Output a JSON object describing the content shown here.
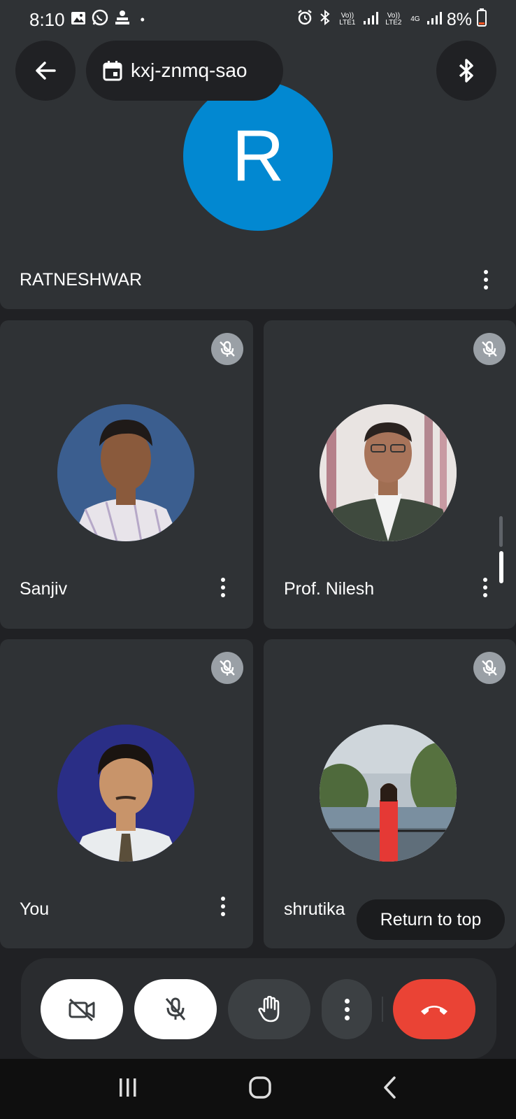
{
  "status_bar": {
    "time": "8:10",
    "sim1_label": "Vo)) LTE1",
    "sim2_label": "Vo)) LTE2",
    "net_label": "4G",
    "battery": "8%",
    "icons": [
      "gallery-icon",
      "whatsapp-icon",
      "app-icon",
      "dot-icon",
      "alarm-icon",
      "bluetooth-icon",
      "signal-icon",
      "battery-icon"
    ]
  },
  "header": {
    "meeting_code": "kxj-znmq-sao"
  },
  "participants": [
    {
      "name": "RATNESHWAR",
      "initial": "R",
      "avatar_color": "#0288d1",
      "muted": false
    },
    {
      "name": "Sanjiv",
      "muted": true
    },
    {
      "name": "Prof. Nilesh",
      "muted": true
    },
    {
      "name": "You",
      "muted": true
    },
    {
      "name": "shrutika",
      "muted": true
    }
  ],
  "return_to_top": "Return to top",
  "controls": {
    "camera": "camera-off-icon",
    "mic": "mic-off-icon",
    "hand": "raise-hand-icon",
    "more": "more-vert-icon",
    "end_call": "end-call-icon"
  },
  "colors": {
    "background": "#202124",
    "tile": "#2f3235",
    "accent_blue": "#0288d1",
    "end_call_red": "#ea4335"
  }
}
